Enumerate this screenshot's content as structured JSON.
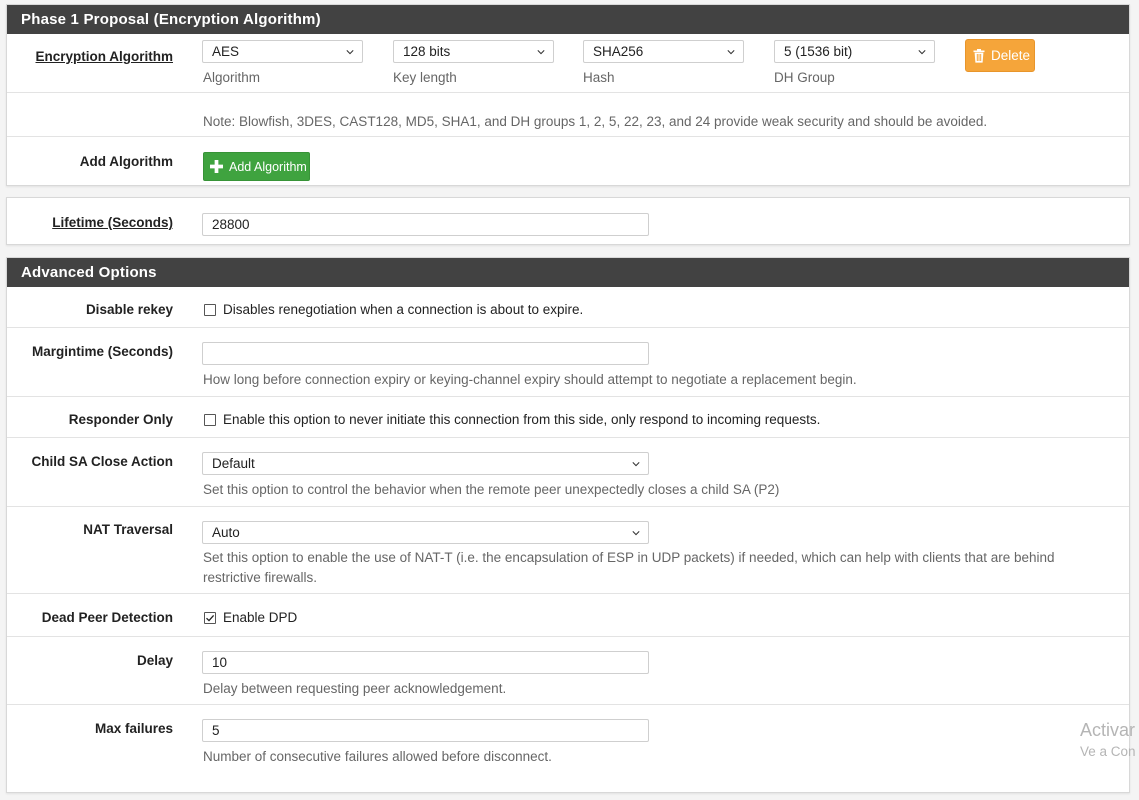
{
  "phase1": {
    "heading": "Phase 1 Proposal (Encryption Algorithm)",
    "encryption": {
      "label": "Encryption Algorithm",
      "algorithm": {
        "value": "AES",
        "caption": "Algorithm"
      },
      "key_length": {
        "value": "128 bits",
        "caption": "Key length"
      },
      "hash": {
        "value": "SHA256",
        "caption": "Hash"
      },
      "dh_group": {
        "value": "5 (1536 bit)",
        "caption": "DH Group"
      },
      "delete_label": "Delete"
    },
    "note": "Note: Blowfish, 3DES, CAST128, MD5, SHA1, and DH groups 1, 2, 5, 22, 23, and 24 provide weak security and should be avoided.",
    "add_algorithm": {
      "label": "Add Algorithm",
      "button_label": "Add Algorithm"
    }
  },
  "lifetime": {
    "label": "Lifetime (Seconds)",
    "value": "28800"
  },
  "advanced": {
    "heading": "Advanced Options",
    "disable_rekey": {
      "label": "Disable rekey",
      "checked": false,
      "text": "Disables renegotiation when a connection is about to expire."
    },
    "margintime": {
      "label": "Margintime (Seconds)",
      "value": "",
      "hint": "How long before connection expiry or keying-channel expiry should attempt to negotiate a replacement begin."
    },
    "responder_only": {
      "label": "Responder Only",
      "checked": false,
      "text": "Enable this option to never initiate this connection from this side, only respond to incoming requests."
    },
    "child_sa": {
      "label": "Child SA Close Action",
      "value": "Default",
      "hint": "Set this option to control the behavior when the remote peer unexpectedly closes a child SA (P2)"
    },
    "nat_traversal": {
      "label": "NAT Traversal",
      "value": "Auto",
      "hint_line1": "Set this option to enable the use of NAT-T (i.e. the encapsulation of ESP in UDP packets) if needed, which can help with clients that are behind",
      "hint_line2": "restrictive firewalls."
    },
    "dpd": {
      "label": "Dead Peer Detection",
      "checked": true,
      "text": "Enable DPD"
    },
    "delay": {
      "label": "Delay",
      "value": "10",
      "hint": "Delay between requesting peer acknowledgement."
    },
    "max_failures": {
      "label": "Max failures",
      "value": "5",
      "hint": "Number of consecutive failures allowed before disconnect."
    }
  },
  "watermark": {
    "line1": "Activar",
    "line2": "Ve a Con"
  },
  "colors": {
    "heading_bg": "#424242",
    "delete_button": "#f5a53a",
    "add_button": "#3fa33f"
  }
}
